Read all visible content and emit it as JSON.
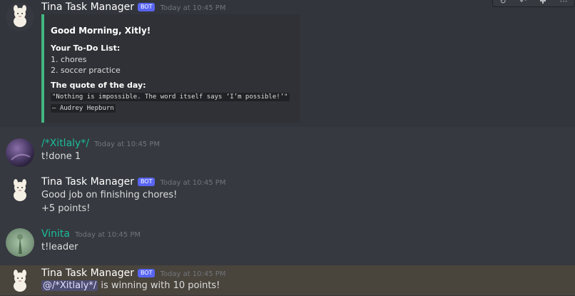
{
  "messages": [
    {
      "author": "Tina Task Manager",
      "badge": "BOT",
      "time": "Today at 10:45 PM",
      "embed": {
        "title": "Good Morning, Xitly!",
        "todo_heading": "Your To-Do List:",
        "todo_items": [
          "1. chores",
          "2. soccer practice"
        ],
        "quote_heading": "The quote of the day:",
        "quote_text": "\"Nothing is impossible. The word itself says ‘I’m possible!’\"",
        "quote_author": "— Audrey Hepburn"
      }
    },
    {
      "author": "/*Xitlaly*/",
      "time": "Today at 10:45 PM",
      "lines": [
        "t!done 1"
      ]
    },
    {
      "author": "Tina Task Manager",
      "badge": "BOT",
      "time": "Today at 10:45 PM",
      "lines": [
        "Good job on finishing chores!",
        "+5 points!"
      ]
    },
    {
      "author": "Vinita",
      "time": "Today at 10:45 PM",
      "lines": [
        "t!leader"
      ]
    },
    {
      "author": "Tina Task Manager",
      "badge": "BOT",
      "time": "Today at 10:45 PM",
      "mention": "@/*Xitlaly*/",
      "line_rest": " is winning with 10 points!"
    }
  ],
  "toolbar": {
    "icons": [
      "reaction-icon",
      "reply-icon",
      "add-reaction-icon",
      "more-icon"
    ],
    "glyphs": [
      "↻",
      "↶",
      "✚",
      "⋯"
    ]
  },
  "colors": {
    "background": "#36393f",
    "embed_bg": "#2f3136",
    "embed_accent": "#43b581",
    "bot_badge": "#5865f2",
    "username_cyan": "#1abc9c",
    "mention_highlight": "#49443c"
  }
}
